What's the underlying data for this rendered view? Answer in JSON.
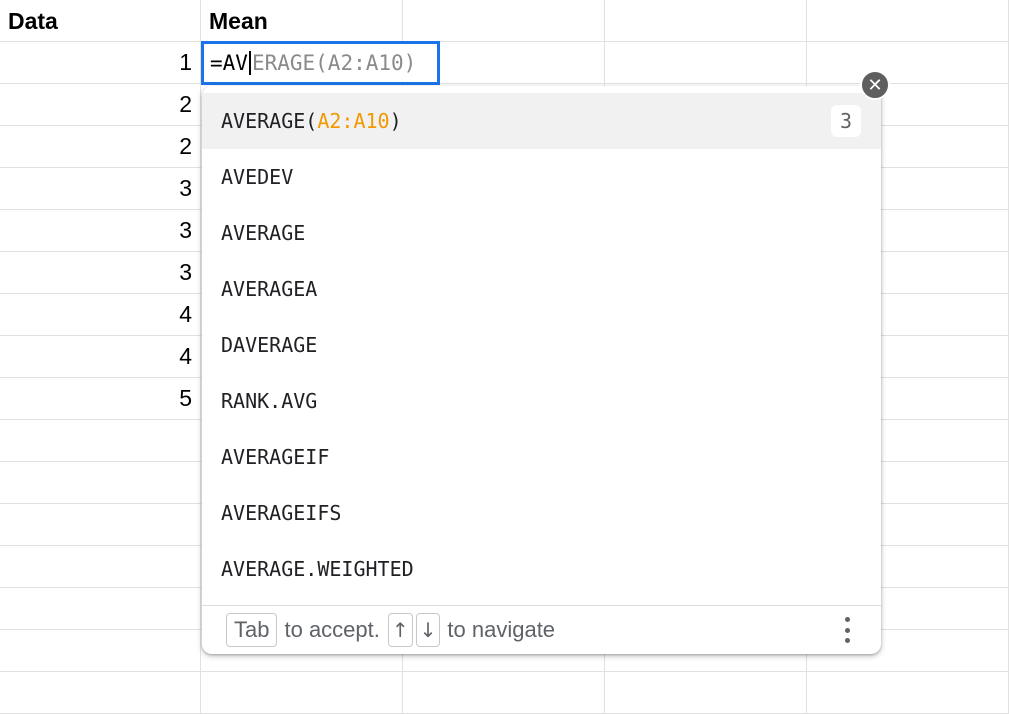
{
  "sheet": {
    "headers": [
      "Data",
      "Mean"
    ],
    "data_column": [
      "1",
      "2",
      "2",
      "3",
      "3",
      "3",
      "4",
      "4",
      "5"
    ]
  },
  "editor": {
    "typed": "=AV",
    "ghost": "ERAGE(A2:A10)"
  },
  "popup": {
    "suggestions": [
      {
        "name": "AVERAGE(",
        "range": "A2:A10",
        "close": ")",
        "badge": "3"
      },
      {
        "name": "AVEDEV"
      },
      {
        "name": "AVERAGE"
      },
      {
        "name": "AVERAGEA"
      },
      {
        "name": "DAVERAGE"
      },
      {
        "name": "RANK.AVG"
      },
      {
        "name": "AVERAGEIF"
      },
      {
        "name": "AVERAGEIFS"
      },
      {
        "name": "AVERAGE.WEIGHTED"
      }
    ],
    "footer": {
      "tab_key": "Tab",
      "accept_text": "to accept.",
      "up_key": "↑",
      "down_key": "↓",
      "navigate_text": "to navigate"
    }
  },
  "icons": {
    "close": "close-icon",
    "more": "more-vert-icon"
  },
  "colors": {
    "active_border": "#1a73e8",
    "range_highlight": "#f29900"
  }
}
